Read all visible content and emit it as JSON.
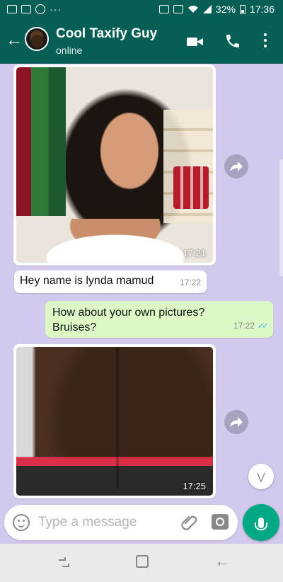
{
  "status_bar": {
    "battery": "32%",
    "time": "17:36",
    "dots": "···"
  },
  "header": {
    "contact_name": "Cool Taxify Guy",
    "status": "online"
  },
  "messages": [
    {
      "type": "image",
      "direction": "in",
      "time": "17:21",
      "content": "selfie-photo"
    },
    {
      "type": "text",
      "direction": "in",
      "text": "Hey name is lynda mamud",
      "time": "17:22"
    },
    {
      "type": "text",
      "direction": "out",
      "text": "How about your own pictures? Bruises?",
      "time": "17:22",
      "read": true
    },
    {
      "type": "image",
      "direction": "in",
      "time": "17:25",
      "content": "back-photo"
    }
  ],
  "composer": {
    "placeholder": "Type a message"
  },
  "colors": {
    "header": "#075e54",
    "chat_bg": "#d3c9ec",
    "outgoing": "#dcf8c6",
    "incoming": "#ffffff",
    "mic": "#00a884",
    "read_ticks": "#4fb6ec"
  },
  "icons": [
    "back-arrow-icon",
    "video-call-icon",
    "phone-icon",
    "more-vert-icon",
    "forward-icon",
    "double-check-icon",
    "chevron-down-icon",
    "emoji-icon",
    "attach-icon",
    "camera-icon",
    "mic-icon",
    "recent-apps-icon",
    "home-icon",
    "back-icon"
  ]
}
